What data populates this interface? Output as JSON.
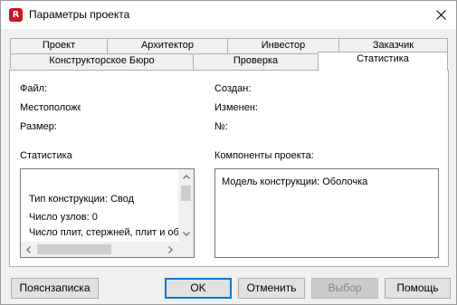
{
  "window": {
    "title": "Параметры проекта",
    "app_icon_letter": "R",
    "app_icon_color": "#d0121c"
  },
  "tabs": {
    "row1": [
      "Проект",
      "Архитектор",
      "Инвестор",
      "Заказчик"
    ],
    "row2": [
      "Конструкторское Бюро",
      "Проверка",
      "Статистика"
    ],
    "active": "Статистика"
  },
  "info": {
    "file_label": "Файл:",
    "location_label": "Местоположение:",
    "size_label": "Размер:",
    "created_label": "Создан:",
    "modified_label": "Изменен:",
    "number_label": "№:"
  },
  "statistics": {
    "title": "Статистика",
    "lines": [
      "Тип конструкции: Свод",
      "Число узлов: 0",
      "Число плит, стержней, плит и об"
    ]
  },
  "components": {
    "title": "Компоненты проекта:",
    "lines": [
      "Модель конструкции: Оболочка"
    ]
  },
  "buttons": {
    "note": "Пояснзаписка",
    "ok": "OK",
    "cancel": "Отменить",
    "select": "Выбор",
    "help": "Помощь"
  },
  "icons": {
    "close": "close-icon",
    "scroll_up": "chevron-up-icon",
    "scroll_down": "chevron-down-icon",
    "scroll_left": "chevron-left-icon",
    "scroll_right": "chevron-right-icon"
  },
  "colors": {
    "accent": "#0078d7",
    "tab_panel_bg": "#ffffff",
    "window_bg": "#f0f0f0"
  }
}
